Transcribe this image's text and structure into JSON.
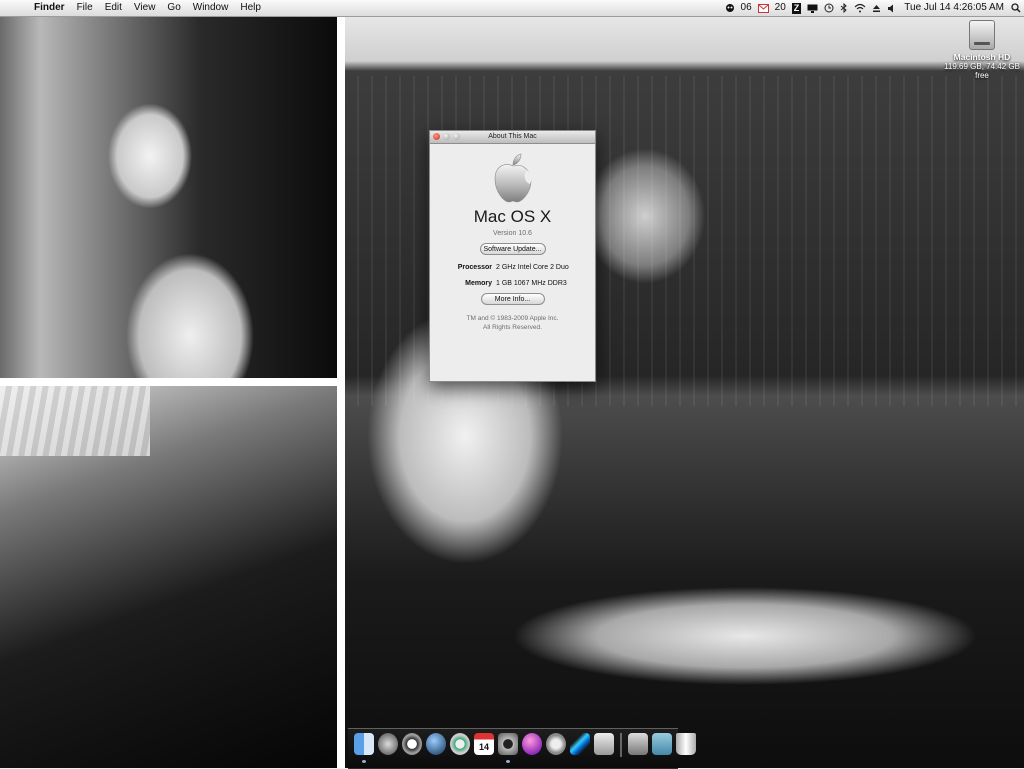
{
  "menubar": {
    "app_name": "Finder",
    "menus": [
      "File",
      "Edit",
      "View",
      "Go",
      "Window",
      "Help"
    ],
    "tray": {
      "count_06": "06",
      "mail_count": "20",
      "letter_z": "Z"
    },
    "clock": "Tue Jul 14  4:26:05 AM"
  },
  "desktop": {
    "hd_name": "Macintosh HD",
    "hd_info": "119.69 GB, 74.42 GB free"
  },
  "about": {
    "title": "About This Mac",
    "os_name": "Mac OS X",
    "version": "Version 10.6",
    "software_update": "Software Update...",
    "processor_label": "Processor",
    "processor_value": "2 GHz Intel Core 2 Duo",
    "memory_label": "Memory",
    "memory_value": "1 GB 1067 MHz DDR3",
    "more_info": "More Info...",
    "copyright_1": "TM and © 1983-2009 Apple Inc.",
    "copyright_2": "All Rights Reserved."
  },
  "dock": {
    "calendar_day": "14",
    "items": [
      "finder-icon",
      "dashboard-icon",
      "clock-icon",
      "globe-icon",
      "safari-icon",
      "calendar-icon",
      "camera-icon",
      "purple-orb-icon",
      "itunes-icon",
      "feather-icon",
      "system-prefs-icon",
      "stack-icon",
      "folder-icon",
      "trash-icon"
    ]
  }
}
